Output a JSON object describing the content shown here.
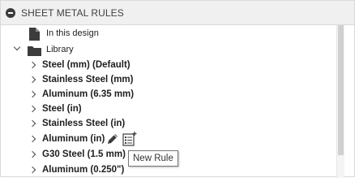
{
  "panel": {
    "title": "SHEET METAL RULES"
  },
  "tree": {
    "in_this_design": "In this design",
    "library": "Library",
    "rules": [
      "Steel (mm) (Default)",
      "Stainless Steel (mm)",
      "Aluminum (6.35 mm)",
      "Steel (in)",
      "Stainless Steel (in)",
      "Aluminum (in)",
      "G30 Steel (1.5 mm)",
      "Aluminum (0.250\")"
    ]
  },
  "tooltip": {
    "text": "New Rule"
  },
  "icons": {
    "collapse": "minus-circle-icon",
    "document": "document-icon",
    "folder": "folder-icon",
    "edit": "pencil-icon",
    "new_rule": "new-rule-list-icon"
  },
  "colors": {
    "header_bg": "#f0f0f0",
    "text": "#202020",
    "icon": "#3c3c3c"
  }
}
